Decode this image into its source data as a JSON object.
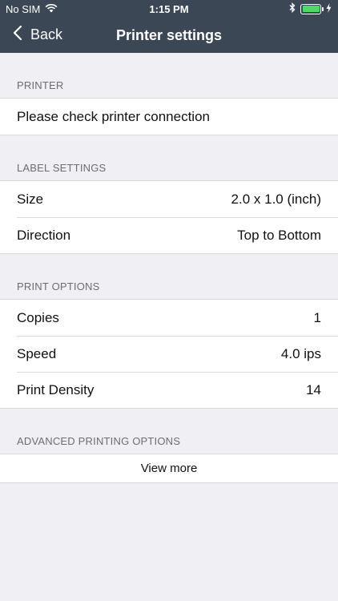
{
  "status_bar": {
    "carrier": "No SIM",
    "time": "1:15 PM",
    "battery_level": 1.0,
    "battery_color": "#4cd964"
  },
  "nav": {
    "back_label": "Back",
    "title": "Printer settings",
    "bar_color": "#3c4756"
  },
  "sections": {
    "printer": {
      "header": "PRINTER",
      "status_text": "Please check printer connection"
    },
    "label_settings": {
      "header": "LABEL SETTINGS",
      "rows": [
        {
          "label": "Size",
          "value": "2.0 x 1.0 (inch)"
        },
        {
          "label": "Direction",
          "value": "Top to Bottom"
        }
      ]
    },
    "print_options": {
      "header": "PRINT OPTIONS",
      "rows": [
        {
          "label": "Copies",
          "value": "1"
        },
        {
          "label": "Speed",
          "value": "4.0 ips"
        },
        {
          "label": "Print Density",
          "value": "14"
        }
      ]
    },
    "advanced": {
      "header": "ADVANCED PRINTING OPTIONS",
      "view_more_label": "View more"
    }
  }
}
